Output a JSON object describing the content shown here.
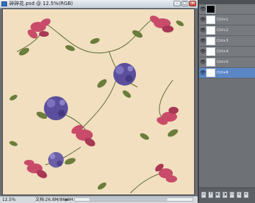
{
  "window": {
    "title": "碎碎花.psd @ 12.5%(RGB)",
    "buttons": {
      "minimize": "–",
      "maximize": "□",
      "close": "×"
    }
  },
  "statusbar": {
    "zoom": "12.5%",
    "doc_info": "文档:26.8M/86.9M",
    "arrow": "▶"
  },
  "layers_panel": {
    "layers": [
      {
        "name": "",
        "thumb": "black",
        "visible": true
      },
      {
        "name": "Ctrl+1",
        "thumb": "white",
        "visible": true
      },
      {
        "name": "Ctrl+2",
        "thumb": "white",
        "visible": true
      },
      {
        "name": "Ctrl+3",
        "thumb": "white",
        "visible": true
      },
      {
        "name": "Ctrl+4",
        "thumb": "white",
        "visible": true
      },
      {
        "name": "Ctrl+5",
        "thumb": "white",
        "visible": true
      },
      {
        "name": "Ctrl+6",
        "thumb": "white",
        "visible": true
      }
    ],
    "selected_index": 6,
    "bottom_buttons": [
      "link-icon",
      "fx-icon",
      "mask-icon",
      "adjust-icon",
      "folder-icon",
      "new-layer-icon",
      "trash-icon"
    ]
  },
  "colors": {
    "canvas_bg": "#f1dfbf",
    "pink": "#c94b6a",
    "purple": "#5b4f9d",
    "leaf": "#6b7d3b",
    "selection": "#5b87c6"
  }
}
